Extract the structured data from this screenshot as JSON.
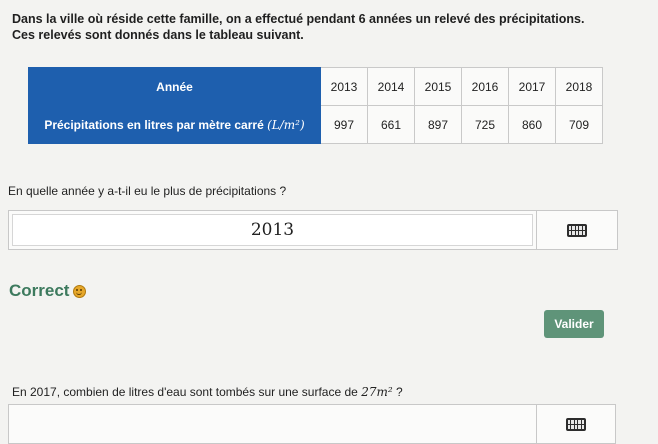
{
  "intro": {
    "line1": "Dans la ville où réside cette famille, on a effectué pendant 6 années un relevé des précipitations.",
    "line2": "Ces relevés sont donnés dans le tableau suivant."
  },
  "table": {
    "year_header": "Année",
    "precip_header": "Précipitations en litres par mètre carré",
    "precip_unit": "(L/m²)",
    "years": [
      "2013",
      "2014",
      "2015",
      "2016",
      "2017",
      "2018"
    ],
    "values": [
      "997",
      "661",
      "897",
      "725",
      "860",
      "709"
    ]
  },
  "question1": {
    "text": "En quelle année y a-t-il eu le plus de précipitations ?",
    "answer": "2013",
    "feedback": "Correct",
    "keyboard_icon": "keyboard-icon",
    "feedback_icon": "smiley-icon"
  },
  "validate_label": "Valider",
  "question2": {
    "text_before": "En 2017, combien de litres d'eau sont tombés sur une surface de",
    "math": "27m²",
    "text_after": "?",
    "answer": "",
    "keyboard_icon": "keyboard-icon"
  },
  "colors": {
    "header_blue": "#1e5fae",
    "correct_green": "#3d7a5e",
    "button_green": "#5f9479"
  }
}
